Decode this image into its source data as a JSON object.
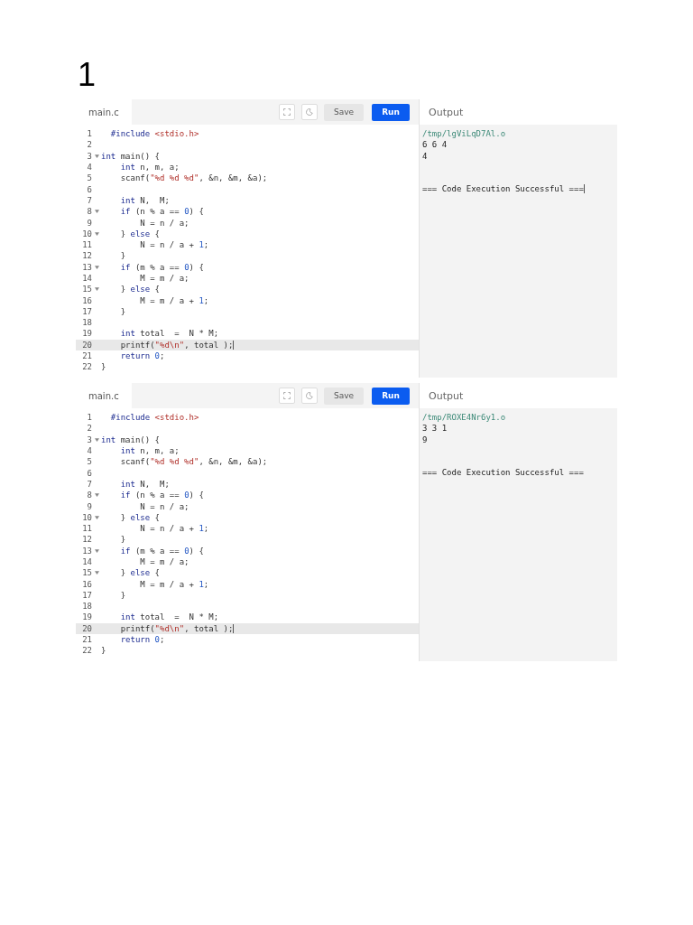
{
  "heading": "1",
  "panels": [
    {
      "tab": "main.c",
      "save": "Save",
      "run": "Run",
      "output_title": "Output",
      "lines": [
        {
          "num": "1",
          "foldable": false,
          "current": false,
          "code": [
            {
              "text": "  #include ",
              "kind": "directive"
            },
            {
              "text": "<stdio.h>",
              "kind": "string"
            }
          ]
        },
        {
          "num": "2",
          "foldable": false,
          "current": false
        },
        {
          "num": "3",
          "foldable": true,
          "current": false,
          "code": [
            {
              "text": "int",
              "kind": "keyword"
            },
            {
              "text": " main() {",
              "kind": "plain"
            }
          ]
        },
        {
          "num": "4",
          "foldable": false,
          "current": false,
          "code": [
            {
              "text": "    int",
              "kind": "keyword"
            },
            {
              "text": " n, m, a;",
              "kind": "plain"
            }
          ]
        },
        {
          "num": "5",
          "foldable": false,
          "current": false,
          "code": [
            {
              "text": "    scanf(",
              "kind": "plain"
            },
            {
              "text": "\"%d %d %d\"",
              "kind": "string"
            },
            {
              "text": ", &n, &m, &a);",
              "kind": "plain"
            }
          ]
        },
        {
          "num": "6",
          "foldable": false,
          "current": false
        },
        {
          "num": "7",
          "foldable": false,
          "current": false,
          "code": [
            {
              "text": "    int",
              "kind": "keyword"
            },
            {
              "text": " N,  M;",
              "kind": "plain"
            }
          ]
        },
        {
          "num": "8",
          "foldable": true,
          "current": false,
          "code": [
            {
              "text": "    if",
              "kind": "keyword"
            },
            {
              "text": " (n % a == ",
              "kind": "plain"
            },
            {
              "text": "0",
              "kind": "number"
            },
            {
              "text": ") {",
              "kind": "plain"
            }
          ]
        },
        {
          "num": "9",
          "foldable": false,
          "current": false,
          "code": [
            {
              "text": "        N = n / a;",
              "kind": "plain"
            }
          ]
        },
        {
          "num": "10",
          "foldable": true,
          "current": false,
          "code": [
            {
              "text": "    } ",
              "kind": "plain"
            },
            {
              "text": "else",
              "kind": "keyword"
            },
            {
              "text": " {",
              "kind": "plain"
            }
          ]
        },
        {
          "num": "11",
          "foldable": false,
          "current": false,
          "code": [
            {
              "text": "        N = n / a + ",
              "kind": "plain"
            },
            {
              "text": "1",
              "kind": "number"
            },
            {
              "text": ";",
              "kind": "plain"
            }
          ]
        },
        {
          "num": "12",
          "foldable": false,
          "current": false,
          "code": [
            {
              "text": "    }",
              "kind": "plain"
            }
          ]
        },
        {
          "num": "13",
          "foldable": true,
          "current": false,
          "code": [
            {
              "text": "    if",
              "kind": "keyword"
            },
            {
              "text": " (m % a == ",
              "kind": "plain"
            },
            {
              "text": "0",
              "kind": "number"
            },
            {
              "text": ") {",
              "kind": "plain"
            }
          ]
        },
        {
          "num": "14",
          "foldable": false,
          "current": false,
          "code": [
            {
              "text": "        M = m / a;",
              "kind": "plain"
            }
          ]
        },
        {
          "num": "15",
          "foldable": true,
          "current": false,
          "code": [
            {
              "text": "    } ",
              "kind": "plain"
            },
            {
              "text": "else",
              "kind": "keyword"
            },
            {
              "text": " {",
              "kind": "plain"
            }
          ]
        },
        {
          "num": "16",
          "foldable": false,
          "current": false,
          "code": [
            {
              "text": "        M = m / a + ",
              "kind": "plain"
            },
            {
              "text": "1",
              "kind": "number"
            },
            {
              "text": ";",
              "kind": "plain"
            }
          ]
        },
        {
          "num": "17",
          "foldable": false,
          "current": false,
          "code": [
            {
              "text": "    }",
              "kind": "plain"
            }
          ]
        },
        {
          "num": "18",
          "foldable": false,
          "current": false
        },
        {
          "num": "19",
          "foldable": false,
          "current": false,
          "code": [
            {
              "text": "    int",
              "kind": "keyword"
            },
            {
              "text": " total  =  N * M;",
              "kind": "plain"
            }
          ]
        },
        {
          "num": "20",
          "foldable": false,
          "current": true,
          "code": [
            {
              "text": "    printf(",
              "kind": "plain"
            },
            {
              "text": "\"%d\\n\"",
              "kind": "string"
            },
            {
              "text": ", total );",
              "kind": "plain"
            }
          ]
        },
        {
          "num": "21",
          "foldable": false,
          "current": false,
          "code": [
            {
              "text": "    return ",
              "kind": "keyword"
            },
            {
              "text": "0",
              "kind": "number"
            },
            {
              "text": ";",
              "kind": "plain"
            }
          ]
        },
        {
          "num": "22",
          "foldable": false,
          "current": false,
          "code": [
            {
              "text": "}",
              "kind": "plain"
            }
          ]
        }
      ],
      "output": [
        {
          "text": "/tmp/lgViLqD7Al.o",
          "kind": "path",
          "cursor": false
        },
        {
          "text": "6 6 4",
          "kind": "text",
          "cursor": false
        },
        {
          "text": "4",
          "kind": "text",
          "cursor": false
        },
        {
          "text": "=== Code Execution Successful ===",
          "kind": "status",
          "cursor": true
        }
      ]
    },
    {
      "tab": "main.c",
      "save": "Save",
      "run": "Run",
      "output_title": "Output",
      "lines": [
        {
          "num": "1",
          "foldable": false,
          "current": false,
          "code": [
            {
              "text": "  #include ",
              "kind": "directive"
            },
            {
              "text": "<stdio.h>",
              "kind": "string"
            }
          ]
        },
        {
          "num": "2",
          "foldable": false,
          "current": false
        },
        {
          "num": "3",
          "foldable": true,
          "current": false,
          "code": [
            {
              "text": "int",
              "kind": "keyword"
            },
            {
              "text": " main() {",
              "kind": "plain"
            }
          ]
        },
        {
          "num": "4",
          "foldable": false,
          "current": false,
          "code": [
            {
              "text": "    int",
              "kind": "keyword"
            },
            {
              "text": " n, m, a;",
              "kind": "plain"
            }
          ]
        },
        {
          "num": "5",
          "foldable": false,
          "current": false,
          "code": [
            {
              "text": "    scanf(",
              "kind": "plain"
            },
            {
              "text": "\"%d %d %d\"",
              "kind": "string"
            },
            {
              "text": ", &n, &m, &a);",
              "kind": "plain"
            }
          ]
        },
        {
          "num": "6",
          "foldable": false,
          "current": false
        },
        {
          "num": "7",
          "foldable": false,
          "current": false,
          "code": [
            {
              "text": "    int",
              "kind": "keyword"
            },
            {
              "text": " N,  M;",
              "kind": "plain"
            }
          ]
        },
        {
          "num": "8",
          "foldable": true,
          "current": false,
          "code": [
            {
              "text": "    if",
              "kind": "keyword"
            },
            {
              "text": " (n % a == ",
              "kind": "plain"
            },
            {
              "text": "0",
              "kind": "number"
            },
            {
              "text": ") {",
              "kind": "plain"
            }
          ]
        },
        {
          "num": "9",
          "foldable": false,
          "current": false,
          "code": [
            {
              "text": "        N = n / a;",
              "kind": "plain"
            }
          ]
        },
        {
          "num": "10",
          "foldable": true,
          "current": false,
          "code": [
            {
              "text": "    } ",
              "kind": "plain"
            },
            {
              "text": "else",
              "kind": "keyword"
            },
            {
              "text": " {",
              "kind": "plain"
            }
          ]
        },
        {
          "num": "11",
          "foldable": false,
          "current": false,
          "code": [
            {
              "text": "        N = n / a + ",
              "kind": "plain"
            },
            {
              "text": "1",
              "kind": "number"
            },
            {
              "text": ";",
              "kind": "plain"
            }
          ]
        },
        {
          "num": "12",
          "foldable": false,
          "current": false,
          "code": [
            {
              "text": "    }",
              "kind": "plain"
            }
          ]
        },
        {
          "num": "13",
          "foldable": true,
          "current": false,
          "code": [
            {
              "text": "    if",
              "kind": "keyword"
            },
            {
              "text": " (m % a == ",
              "kind": "plain"
            },
            {
              "text": "0",
              "kind": "number"
            },
            {
              "text": ") {",
              "kind": "plain"
            }
          ]
        },
        {
          "num": "14",
          "foldable": false,
          "current": false,
          "code": [
            {
              "text": "        M = m / a;",
              "kind": "plain"
            }
          ]
        },
        {
          "num": "15",
          "foldable": true,
          "current": false,
          "code": [
            {
              "text": "    } ",
              "kind": "plain"
            },
            {
              "text": "else",
              "kind": "keyword"
            },
            {
              "text": " {",
              "kind": "plain"
            }
          ]
        },
        {
          "num": "16",
          "foldable": false,
          "current": false,
          "code": [
            {
              "text": "        M = m / a + ",
              "kind": "plain"
            },
            {
              "text": "1",
              "kind": "number"
            },
            {
              "text": ";",
              "kind": "plain"
            }
          ]
        },
        {
          "num": "17",
          "foldable": false,
          "current": false,
          "code": [
            {
              "text": "    }",
              "kind": "plain"
            }
          ]
        },
        {
          "num": "18",
          "foldable": false,
          "current": false
        },
        {
          "num": "19",
          "foldable": false,
          "current": false,
          "code": [
            {
              "text": "    int",
              "kind": "keyword"
            },
            {
              "text": " total  =  N * M;",
              "kind": "plain"
            }
          ]
        },
        {
          "num": "20",
          "foldable": false,
          "current": true,
          "code": [
            {
              "text": "    printf(",
              "kind": "plain"
            },
            {
              "text": "\"%d\\n\"",
              "kind": "string"
            },
            {
              "text": ", total );",
              "kind": "plain"
            }
          ]
        },
        {
          "num": "21",
          "foldable": false,
          "current": false,
          "code": [
            {
              "text": "    return ",
              "kind": "keyword"
            },
            {
              "text": "0",
              "kind": "number"
            },
            {
              "text": ";",
              "kind": "plain"
            }
          ]
        },
        {
          "num": "22",
          "foldable": false,
          "current": false,
          "code": [
            {
              "text": "}",
              "kind": "plain"
            }
          ]
        }
      ],
      "output": [
        {
          "text": "/tmp/ROXE4Nr6y1.o",
          "kind": "path",
          "cursor": false
        },
        {
          "text": "3 3 1",
          "kind": "text",
          "cursor": false
        },
        {
          "text": "9",
          "kind": "text",
          "cursor": false
        },
        {
          "text": "=== Code Execution Successful ===",
          "kind": "status",
          "cursor": false
        }
      ]
    }
  ]
}
